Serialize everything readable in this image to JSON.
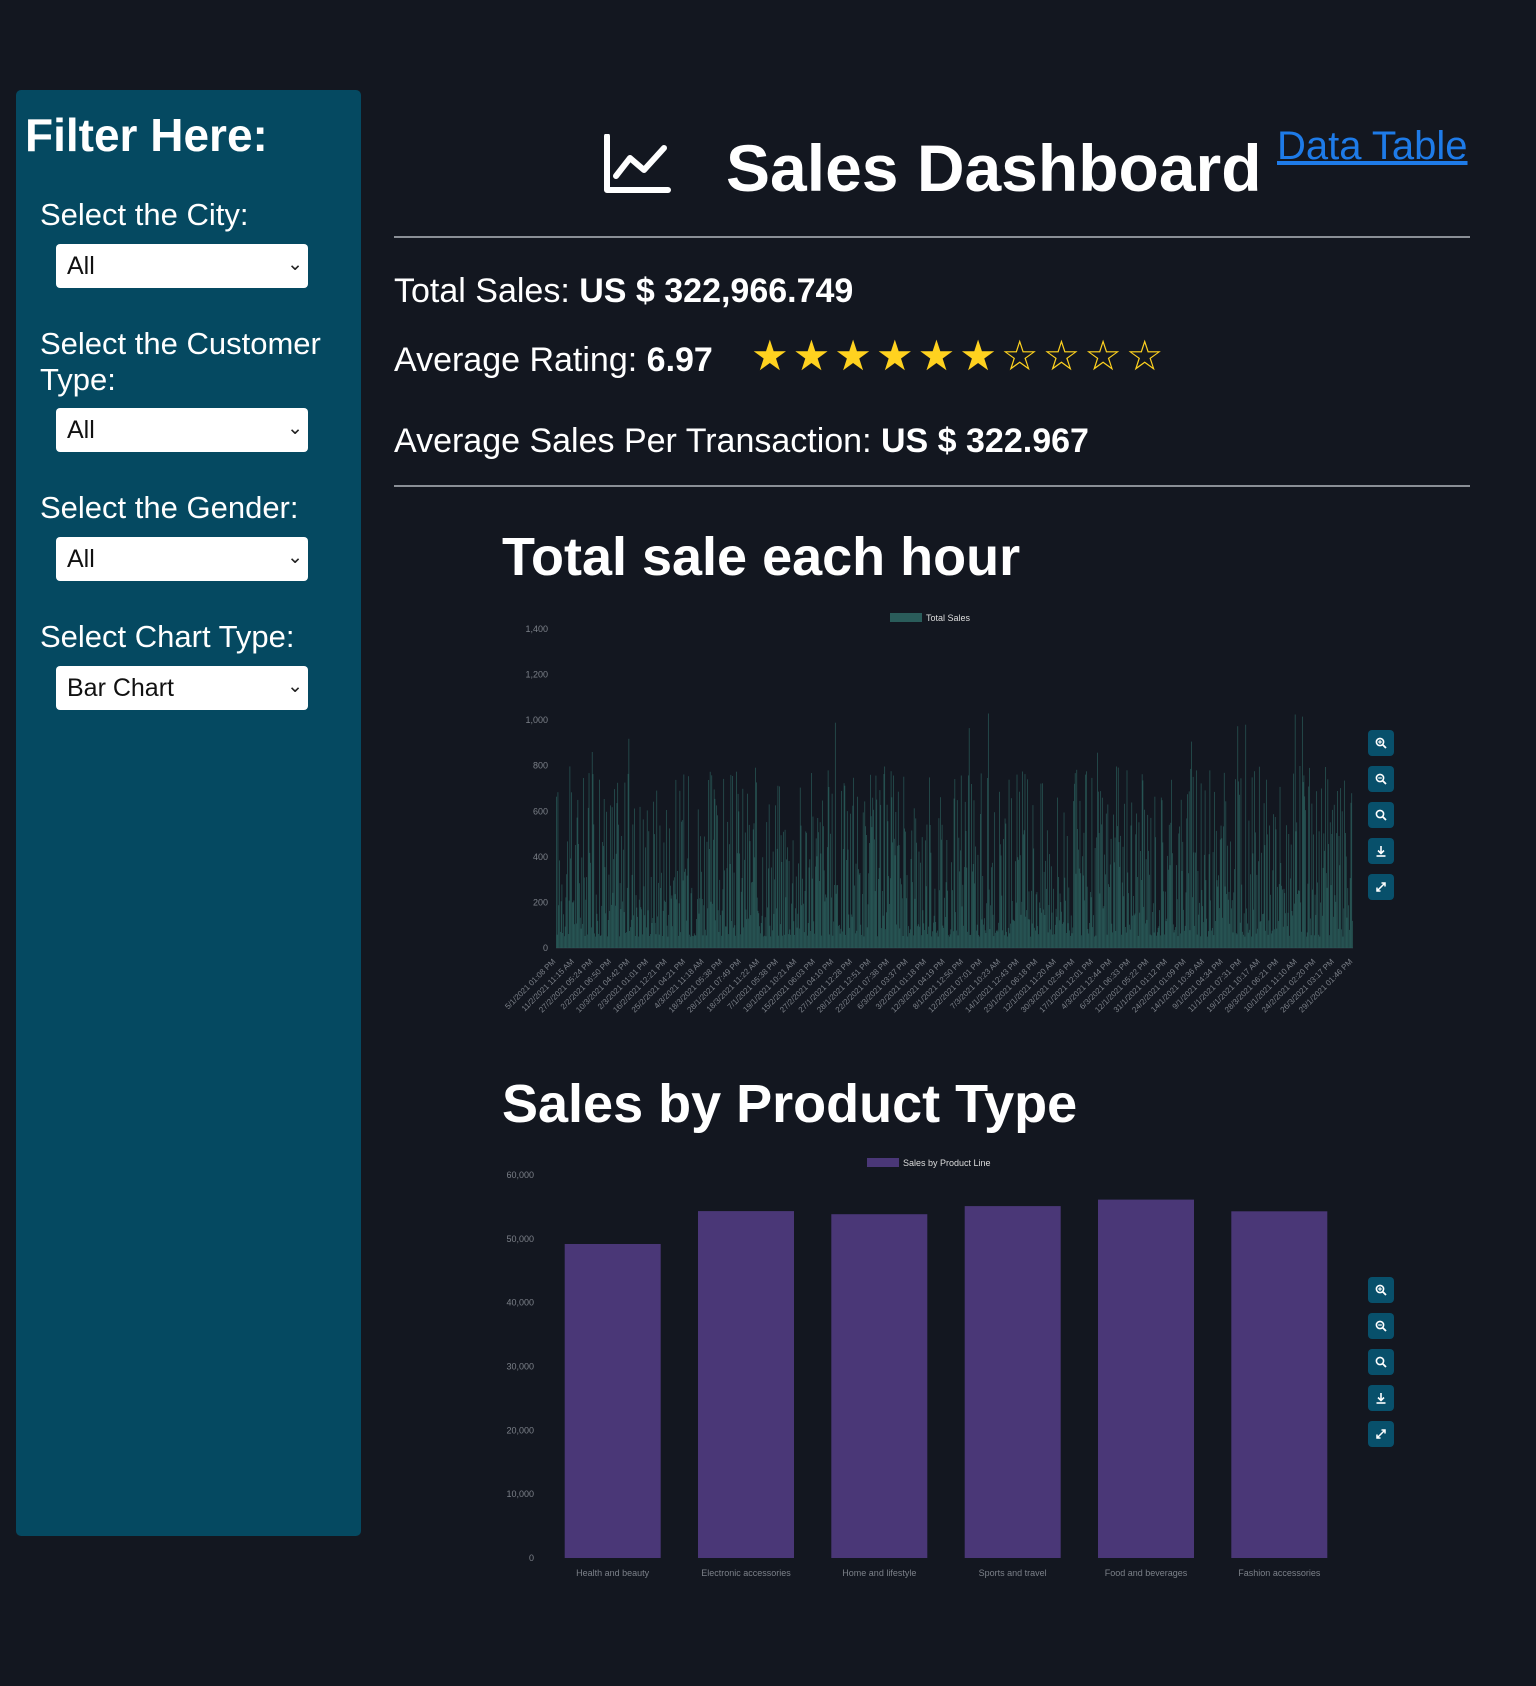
{
  "sidebar": {
    "header": "Filter Here:",
    "filters": [
      {
        "label": "Select the City:",
        "value": "All"
      },
      {
        "label": "Select the Customer Type:",
        "value": "All"
      },
      {
        "label": "Select the Gender:",
        "value": "All"
      },
      {
        "label": "Select Chart Type:",
        "value": "Bar Chart"
      }
    ]
  },
  "header": {
    "title": "Sales Dashboard",
    "link": "Data Table",
    "icon": "line-chart-icon"
  },
  "metrics": {
    "total_sales_label": "Total Sales: ",
    "total_sales_value": "US $ 322,966.749",
    "avg_rating_label": "Average Rating: ",
    "avg_rating_value": "6.97",
    "stars_text": "★★★★★★☆☆☆☆",
    "stars_filled": 6,
    "stars_total": 10,
    "avg_sales_label": "Average Sales Per Transaction: ",
    "avg_sales_value": "US $ 322.967"
  },
  "colors": {
    "background": "#131720",
    "sidebar": "#054961",
    "star": "#ffd21f",
    "link": "#1e7be8",
    "hour_series": "#2a5c5a",
    "product_series": "#4a3777",
    "toolbar_button": "#08506b"
  },
  "toolbar_icons": [
    "zoom-in-icon",
    "zoom-out-icon",
    "reset-zoom-icon",
    "download-icon",
    "fullscreen-icon"
  ],
  "chart_data": [
    {
      "type": "bar",
      "title": "Total sale each hour",
      "legend": [
        "Total Sales"
      ],
      "legend_position": "top",
      "ylim": [
        0,
        1400
      ],
      "yticks": [
        "0",
        "200",
        "400",
        "600",
        "800",
        "1,000",
        "1,200",
        "1,400"
      ],
      "x_tick_labels": [
        "5/1/2021 01:08 PM",
        "11/2/2021 11:15 AM",
        "27/2/2021 05:24 PM",
        "2/2/2021 06:50 PM",
        "10/3/2021 04:42 PM",
        "2/3/2021 01:01 PM",
        "16/2/2021 12:21 PM",
        "25/2/2021 04:21 PM",
        "4/3/2021 11:18 AM",
        "18/3/2021 05:38 PM",
        "28/1/2021 07:49 PM",
        "18/3/2021 11:22 AM",
        "7/1/2021 05:38 PM",
        "19/1/2021 10:21 AM",
        "15/2/2021 06:03 PM",
        "27/2/2021 04:10 PM",
        "27/1/2021 12:28 PM",
        "28/1/2021 12:51 PM",
        "22/2/2021 07:38 PM",
        "6/3/2021 03:37 PM",
        "3/2/2021 01:18 PM",
        "12/3/2021 04:19 PM",
        "8/1/2021 12:50 PM",
        "12/2/2021 07:01 PM",
        "7/3/2021 10:23 AM",
        "14/1/2021 12:43 PM",
        "23/1/2021 06:18 PM",
        "12/1/2021 11:20 AM",
        "30/3/2021 02:56 PM",
        "17/1/2021 12:01 PM",
        "4/3/2021 12:44 PM",
        "6/3/2021 06:33 PM",
        "12/1/2021 05:22 PM",
        "31/1/2021 01:12 PM",
        "24/2/2021 01:09 PM",
        "14/1/2021 10:36 AM",
        "9/1/2021 04:34 PM",
        "11/1/2021 07:31 PM",
        "19/1/2021 10:17 AM",
        "28/3/2021 06:21 PM",
        "10/1/2021 11:10 AM",
        "24/2/2021 02:20 PM",
        "26/3/2021 03:17 PM",
        "29/1/2021 01:46 PM"
      ],
      "series": [
        {
          "name": "Total Sales",
          "color": "#2a5c5a"
        }
      ],
      "bar_count": 1000,
      "value_range": [
        10,
        1042
      ],
      "typical_range": [
        50,
        800
      ]
    },
    {
      "type": "bar",
      "title": "Sales by Product Type",
      "legend": [
        "Sales by Product Line"
      ],
      "legend_position": "top",
      "categories": [
        "Health and beauty",
        "Electronic accessories",
        "Home and lifestyle",
        "Sports and travel",
        "Food and beverages",
        "Fashion accessories"
      ],
      "series": [
        {
          "name": "Sales by Product Line",
          "color": "#4a3777",
          "values": [
            49193.739,
            54337.5315,
            53861.913,
            55122.8265,
            56144.844,
            54305.895
          ]
        }
      ],
      "ylim": [
        0,
        60000
      ],
      "yticks": [
        "0",
        "10,000",
        "20,000",
        "30,000",
        "40,000",
        "50,000",
        "60,000"
      ]
    }
  ]
}
